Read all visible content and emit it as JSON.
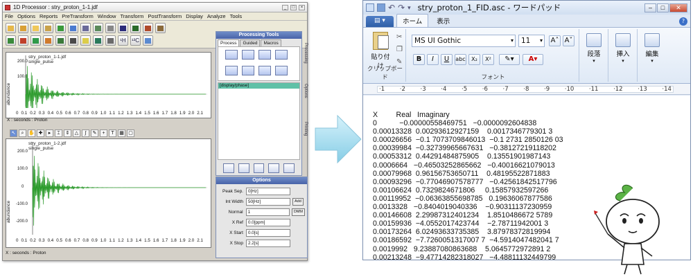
{
  "left_window": {
    "title": "1D Processor : stry_proton_1-1.jdf",
    "menu": [
      "File",
      "Options",
      "Reports",
      "PreTransform",
      "Window",
      "Transform",
      "PostTransform",
      "Display",
      "Analyze",
      "Tools"
    ],
    "toolbar_row2_labels": [
      "¹H",
      "¹³C"
    ],
    "plot_top": {
      "file": "stry_proton_1-1.jdf",
      "pulse": "single_pulse",
      "y_label": "abundance",
      "y_ticks": [
        "200.0",
        "100.0"
      ],
      "x_ticks": [
        "0",
        "0.1",
        "0.2",
        "0.3",
        "0.4",
        "0.5",
        "0.6",
        "0.7",
        "0.8",
        "0.9",
        "1.0",
        "1.1",
        "1.2",
        "1.3",
        "1.4",
        "1.5",
        "1.6",
        "1.7",
        "1.8",
        "1.9",
        "2.0",
        "2.1"
      ],
      "x_label": "X : seconds : Proton"
    },
    "plot_bottom": {
      "file": "stry_proton_1-2.jdf",
      "pulse": "single_pulse",
      "y_label": "abundance",
      "y_ticks": [
        "200.0",
        "100.0",
        "0",
        "-100.0",
        "-200.0"
      ],
      "x_ticks": [
        "0",
        "0.1",
        "0.2",
        "0.3",
        "0.4",
        "0.5",
        "0.6",
        "0.7",
        "0.8",
        "0.9",
        "1.0",
        "1.1",
        "1.2",
        "1.3",
        "1.4",
        "1.5",
        "1.6",
        "1.7",
        "1.8",
        "1.9",
        "2.0",
        "2.1"
      ],
      "x_label": "X : seconds : Proton"
    },
    "processing_tools": {
      "title": "Processing Tools",
      "tabs": [
        "Process",
        "Guided",
        "Macros"
      ],
      "list_item": "[display/phase]",
      "side_tabs": [
        "Processing",
        "Options",
        "Printing"
      ]
    },
    "options": {
      "title": "Options",
      "rows": [
        {
          "label": "Peak Sep.",
          "value": "0[Hz]",
          "button": ""
        },
        {
          "label": "Int Width",
          "value": "50[Hz]",
          "button": "Add"
        },
        {
          "label": "Normal",
          "value": "1",
          "button": "DMM"
        },
        {
          "label": "X Ref",
          "value": "0.0[ppm]",
          "button": ""
        },
        {
          "label": "X Start",
          "value": "0.0[s]",
          "button": ""
        },
        {
          "label": "X Stop",
          "value": "2.2[s]",
          "button": ""
        }
      ]
    }
  },
  "right_window": {
    "title": "stry_proton_1_FID.asc - ワードパッド",
    "tabs": [
      "ホーム",
      "表示"
    ],
    "paste_label": "貼り付け",
    "clipboard_label": "クリップボード",
    "font_name": "MS UI Gothic",
    "font_size": "11",
    "font_group_label": "フォント",
    "paragraph_label": "段落",
    "insert_label": "挿入",
    "edit_label": "編集",
    "ruler": [
      "1",
      "2",
      "3",
      "4",
      "5",
      "6",
      "7",
      "8",
      "9",
      "10",
      "11",
      "12",
      "13",
      "14"
    ],
    "columns": [
      "X",
      "Real",
      "Imaginary"
    ],
    "rows": [
      [
        "0",
        "−0.00000558469751",
        "−0.0000092604838"
      ],
      [
        "0.00013328",
        "0.00293612927159",
        "0.0017346779301 3"
      ],
      [
        "0.00026656",
        "−0.1 7073709846013",
        "−0.1 2731 2850126 03"
      ],
      [
        "0.00039984",
        "−0.32739965667631",
        "−0.38127219118202"
      ],
      [
        "0.00053312",
        "0.44291484875905",
        "0.13551901987143"
      ],
      [
        "0.0006664",
        "−0.46503252865662",
        "−0.40016621079013"
      ],
      [
        "0.00079968",
        "0.96156753650711",
        "0.48195522871883"
      ],
      [
        "0.00093296",
        "−0.77046907578777",
        "−0.42561842517796"
      ],
      [
        "0.00106624",
        "0.7329824671806",
        "0.15857932597266"
      ],
      [
        "0.00119952",
        "−0.06363855698785",
        "0.19636067877586"
      ],
      [
        "0.0013328",
        "−0.8404019040336",
        "−0.90311137230959"
      ],
      [
        "0.00146608",
        "2.29987312401234",
        "1.8510486672 5789"
      ],
      [
        "0.00159936",
        "−4.0552017423744",
        "−2.78711942001 3"
      ],
      [
        "0.00173264",
        "6.02493633735385",
        "3.87978372819994"
      ],
      [
        "0.00186592",
        "−7.7260051317007 7",
        "−4.5914047482041 7"
      ],
      [
        "0.0019992",
        "9.23887080863688",
        "5.0645772972891 2"
      ],
      [
        "0.00213248",
        "−9.47714282318027",
        "−4.48811132449799"
      ]
    ]
  }
}
